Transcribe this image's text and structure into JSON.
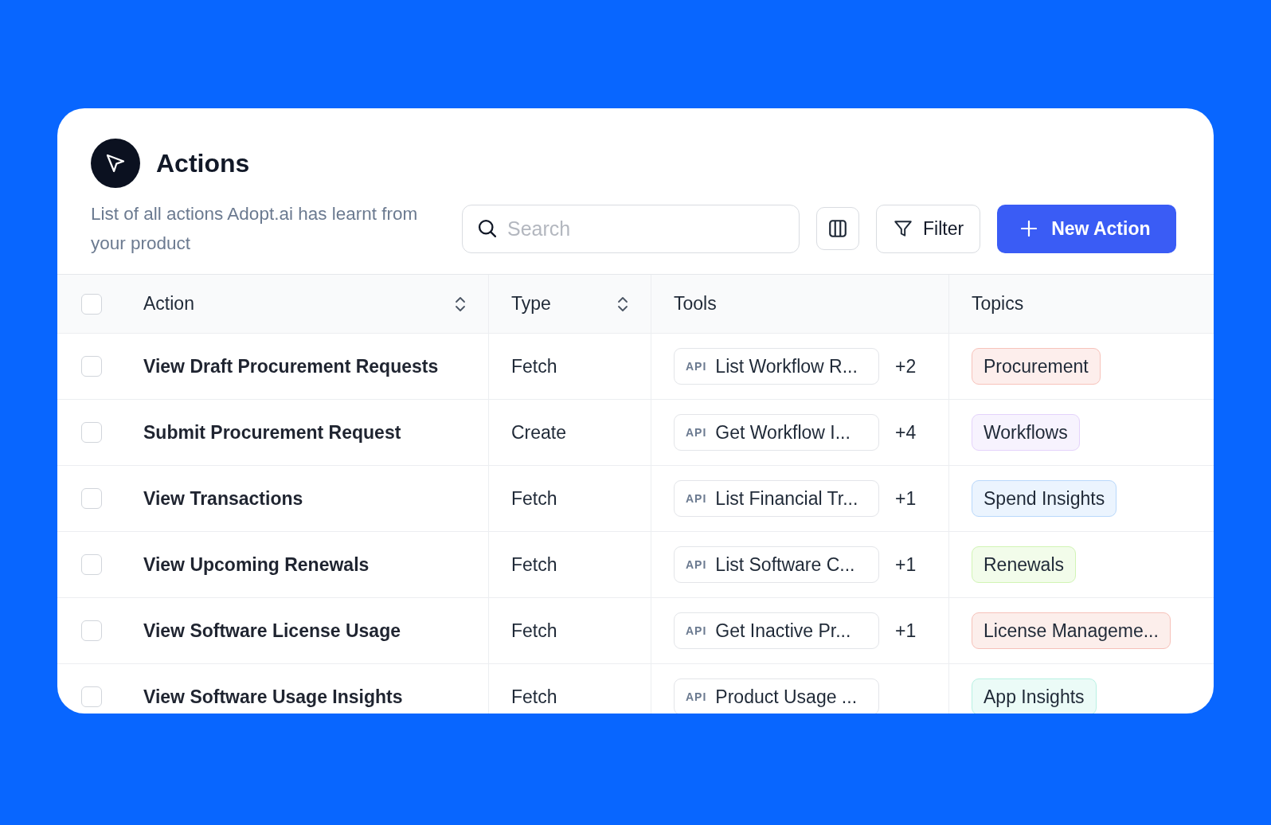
{
  "header": {
    "title": "Actions",
    "description": "List of all actions Adopt.ai has learnt from your product"
  },
  "toolbar": {
    "search": {
      "placeholder": "Search"
    },
    "filter_label": "Filter",
    "new_button_label": "New Action"
  },
  "table": {
    "select_all": {
      "checked": false
    },
    "columns": [
      {
        "label": "Action",
        "sortable": true
      },
      {
        "label": "Type",
        "sortable": true
      },
      {
        "label": "Tools",
        "sortable": false
      },
      {
        "label": "Topics",
        "sortable": false
      }
    ],
    "rows": [
      {
        "checked": false,
        "action": "View Draft Procurement Requests",
        "type": "Fetch",
        "tool": "List Workflow R...",
        "tool_badge": "API",
        "tool_more": "+2",
        "topic": "Procurement",
        "color": "#f7c3bb"
      },
      {
        "checked": false,
        "action": "Submit Procurement Request",
        "type": "Create",
        "tool": "Get Workflow I...",
        "tool_badge": "API",
        "tool_more": "+4",
        "topic": "Workflows",
        "color": "#e4d3fb"
      },
      {
        "checked": false,
        "action": "View Transactions",
        "type": "Fetch",
        "tool": "List Financial Tr...",
        "tool_badge": "API",
        "tool_more": "+1",
        "topic": "Spend Insights",
        "color": "#b9d8fb"
      },
      {
        "checked": false,
        "action": "View Upcoming Renewals",
        "type": "Fetch",
        "tool": "List Software C...",
        "tool_badge": "API",
        "tool_more": "+1",
        "topic": "Renewals",
        "color": "#d1f4b5"
      },
      {
        "checked": false,
        "action": "View Software License Usage",
        "type": "Fetch",
        "tool": "Get Inactive Pr...",
        "tool_badge": "API",
        "tool_more": "+1",
        "topic": "License Manageme...",
        "color": "#f6c1b9"
      },
      {
        "checked": false,
        "action": "View Software Usage Insights",
        "type": "Fetch",
        "tool": "Product Usage ...",
        "tool_badge": "API",
        "topic": "App Insights",
        "color": "#b9f1e3"
      }
    ]
  }
}
